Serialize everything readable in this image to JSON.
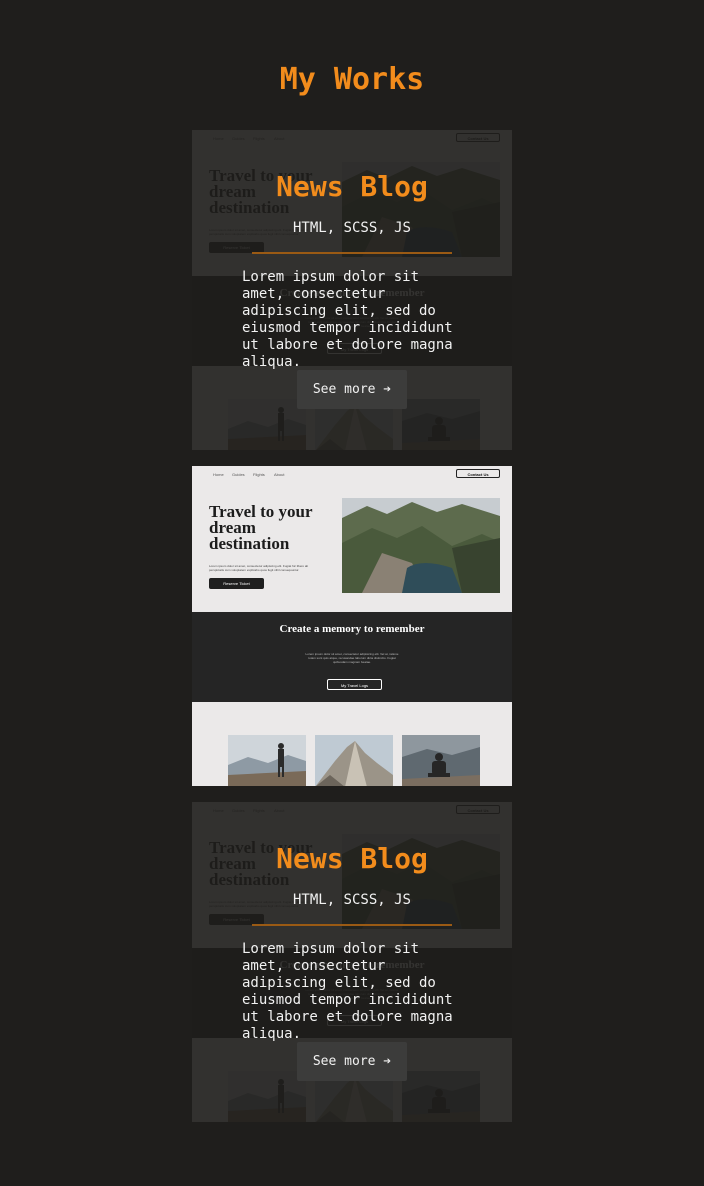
{
  "section": {
    "title": "My Works"
  },
  "preview": {
    "nav": [
      "Home",
      "Guides",
      "Flights",
      "About"
    ],
    "contact": "Contact Us",
    "hero_title": "Travel to your dream destination",
    "hero_sub": "Lorem ipsum dolor sit amet, consectetur adipiscing elit. Fugiat hic libero ab perspiciatis cum voluptatem explicabo quos fugit nihil consequuntur.",
    "reserve": "Reserve Ticket",
    "dark_title": "Create a memory to remember",
    "dark_text": "Lorem ipsum dolor sit amet, consectetur adipisicing elit. Vel at, ratione totam sunt quis atque, recusandae laborum dicta distinctio. Fugiat quibusdam magnam beatae.",
    "dark_btn": "My Travel Logs"
  },
  "projects": [
    {
      "title": "News Blog",
      "tech": "HTML, SCSS, JS",
      "description": "Lorem ipsum dolor sit amet, consectetur adipiscing elit, sed do eiusmod tempor incididunt ut labore et dolore magna aliqua.",
      "button": "See more ➔"
    },
    {
      "title": "News Blog",
      "tech": "HTML, SCSS, JS",
      "description": "Lorem ipsum dolor sit amet, consectetur adipiscing elit, sed do eiusmod tempor incididunt ut labore et dolore magna aliqua.",
      "button": "See more ➔"
    }
  ],
  "colors": {
    "accent": "#f28c1c",
    "background": "#1f1e1c",
    "button": "#3c3c3b"
  }
}
